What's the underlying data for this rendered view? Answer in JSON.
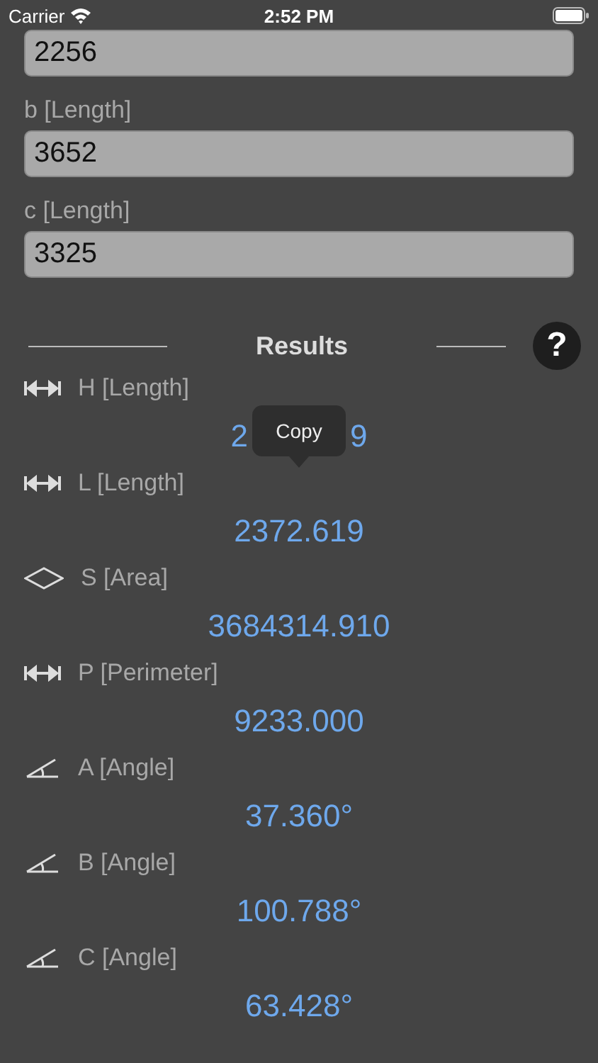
{
  "status_bar": {
    "carrier": "Carrier",
    "time": "2:52 PM"
  },
  "inputs": [
    {
      "value": "2256"
    },
    {
      "label": "b [Length]",
      "value": "3652"
    },
    {
      "label": "c [Length]",
      "value": "3325"
    }
  ],
  "results_header": {
    "title": "Results",
    "help": "?"
  },
  "results": [
    {
      "kind": "length",
      "label": "H [Length]",
      "value_parts": [
        "2",
        "9"
      ],
      "tooltip": "Copy"
    },
    {
      "kind": "length",
      "label": "L [Length]",
      "value_parts": [
        "2372.619"
      ]
    },
    {
      "kind": "area",
      "label": "S [Area]",
      "value_parts": [
        "3684314.910"
      ]
    },
    {
      "kind": "length",
      "label": "P [Perimeter]",
      "value_parts": [
        "9233.000"
      ]
    },
    {
      "kind": "angle",
      "label": "A [Angle]",
      "value_parts": [
        "37.360°"
      ]
    },
    {
      "kind": "angle",
      "label": "B [Angle]",
      "value_parts": [
        "100.788°"
      ]
    },
    {
      "kind": "angle",
      "label": "C [Angle]",
      "value_parts": [
        "63.428°"
      ]
    }
  ]
}
